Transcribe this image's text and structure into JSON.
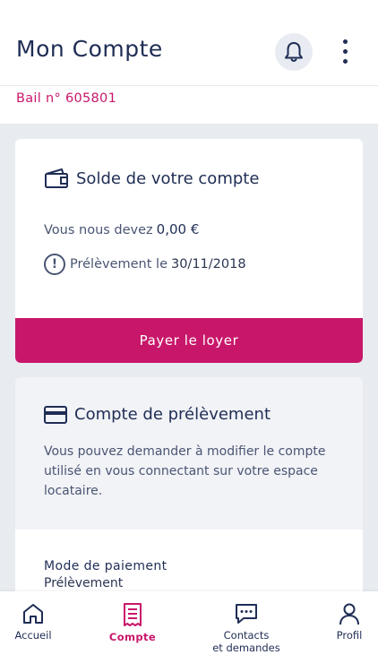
{
  "header": {
    "title": "Mon Compte"
  },
  "lease": {
    "label": "Bail n° 605801"
  },
  "balance_card": {
    "title": "Solde de votre compte",
    "due_text": "Vous nous devez",
    "due_amount": "0,00 €",
    "direct_debit_text": "Prélèvement le",
    "direct_debit_date": "30/11/2018",
    "pay_button": "Payer le loyer"
  },
  "debit_account_card": {
    "title": "Compte de prélèvement",
    "description": "Vous pouvez demander à modifier le compte utilisé en vous connectant sur votre espace locataire.",
    "payment_mode_label": "Mode de paiement",
    "payment_mode_value": "Prélèvement"
  },
  "tabbar": {
    "items": [
      {
        "label": "Accueil",
        "icon": "home-icon",
        "active": false
      },
      {
        "label": "Compte",
        "icon": "receipt-icon",
        "active": true
      },
      {
        "label": "Contacts\net demandes",
        "icon": "chat-icon",
        "active": false
      },
      {
        "label": "Profil",
        "icon": "user-icon",
        "active": false
      }
    ]
  },
  "colors": {
    "primary": "#1f2d55",
    "accent": "#c8176a",
    "background": "#e8ebf0"
  }
}
